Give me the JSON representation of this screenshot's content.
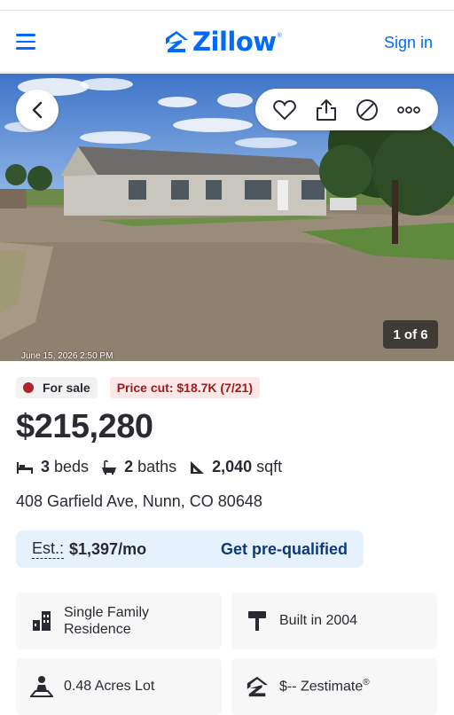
{
  "header": {
    "logo_text": "Zillow",
    "logo_reg": "®",
    "signin_label": "Sign in",
    "brand_color": "#006aff"
  },
  "photo": {
    "counter": "1 of 6",
    "date_stamp": "June 15, 2026 2:50 PM",
    "actions": [
      "heart-icon",
      "share-icon",
      "hide-icon",
      "more-icon"
    ]
  },
  "badges": {
    "for_sale": "For sale",
    "price_cut": "Price cut: $18.7K (7/21)"
  },
  "listing": {
    "price": "$215,280",
    "beds_num": "3",
    "beds_label": "beds",
    "baths_num": "2",
    "baths_label": "baths",
    "sqft_num": "2,040",
    "sqft_label": "sqft",
    "address": "408 Garfield Ave, Nunn, CO 80648"
  },
  "estimate": {
    "label": "Est.:",
    "value": "$1,397/mo",
    "cta": "Get pre-qualified"
  },
  "facts_cards": {
    "type": "Single Family Residence",
    "built": "Built in 2004",
    "lot": "0.48 Acres Lot",
    "zestimate": "$-- Zestimate",
    "zestimate_reg": "®"
  }
}
